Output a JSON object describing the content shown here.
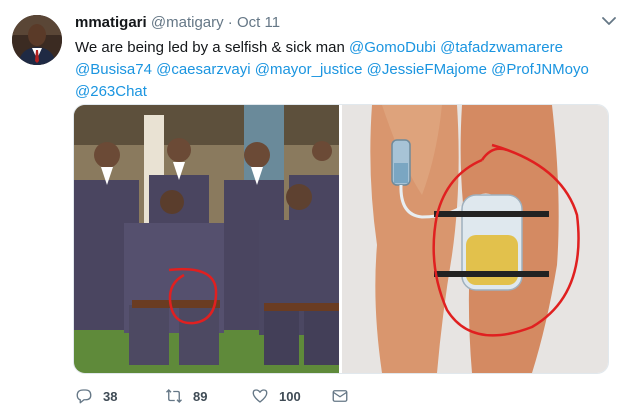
{
  "tweet": {
    "display_name": "mmatigari",
    "handle": "@matigary",
    "separator": "·",
    "time": "Oct 11",
    "text_plain": "We are being led by a selfish & sick man",
    "mentions": [
      "@GomoDubi",
      "@tafadzwamarere",
      "@Busisa74",
      "@caesarzvayi",
      "@mayor_justice",
      "@JessieFMajome",
      "@ProfJNMoyo",
      "@263Chat"
    ]
  },
  "actions": {
    "reply": {
      "icon": "reply-icon",
      "count": "38"
    },
    "retweet": {
      "icon": "retweet-icon",
      "count": "89"
    },
    "like": {
      "icon": "heart-icon",
      "count": "100"
    },
    "dm": {
      "icon": "envelope-icon"
    }
  },
  "colors": {
    "mention": "#1b95e0",
    "name": "#14171a",
    "meta": "#657786",
    "highlight_circle": "#e02020"
  }
}
